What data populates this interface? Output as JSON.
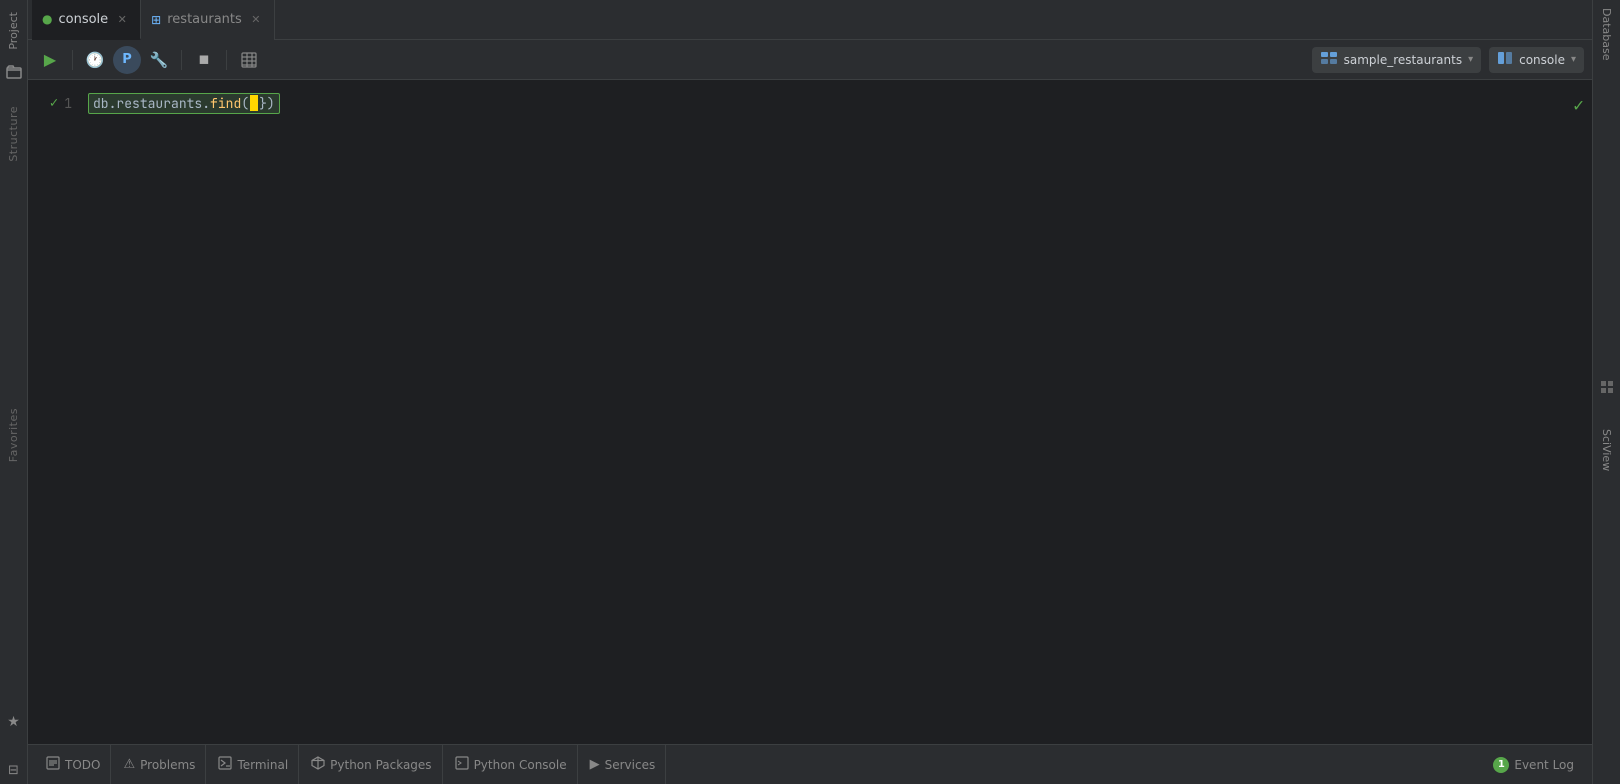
{
  "tabs": [
    {
      "id": "console",
      "label": "console",
      "icon": "🟢",
      "active": true
    },
    {
      "id": "restaurants",
      "label": "restaurants",
      "icon": "⊞",
      "active": false
    }
  ],
  "toolbar": {
    "run_label": "▶",
    "history_label": "🕐",
    "profile_label": "P",
    "settings_label": "🔧",
    "stop_label": "◼",
    "table_label": "≡"
  },
  "db_selector": {
    "label": "sample_restaurants",
    "icon": "🗄"
  },
  "console_selector": {
    "label": "console",
    "icon": "⊟"
  },
  "editor": {
    "line_number": "1",
    "code_prefix": "db.restaurants.find(",
    "code_cursor": "",
    "code_suffix": ")"
  },
  "status_bar": {
    "todo_label": "TODO",
    "problems_label": "Problems",
    "terminal_label": "Terminal",
    "python_packages_label": "Python Packages",
    "python_console_label": "Python Console",
    "services_label": "Services",
    "event_log_label": "Event Log",
    "event_log_count": "1"
  },
  "left_sidebar": {
    "project_label": "Project",
    "structure_label": "Structure",
    "favorites_label": "Favorites"
  },
  "right_sidebar": {
    "database_label": "Database",
    "sciview_label": "SciView"
  }
}
